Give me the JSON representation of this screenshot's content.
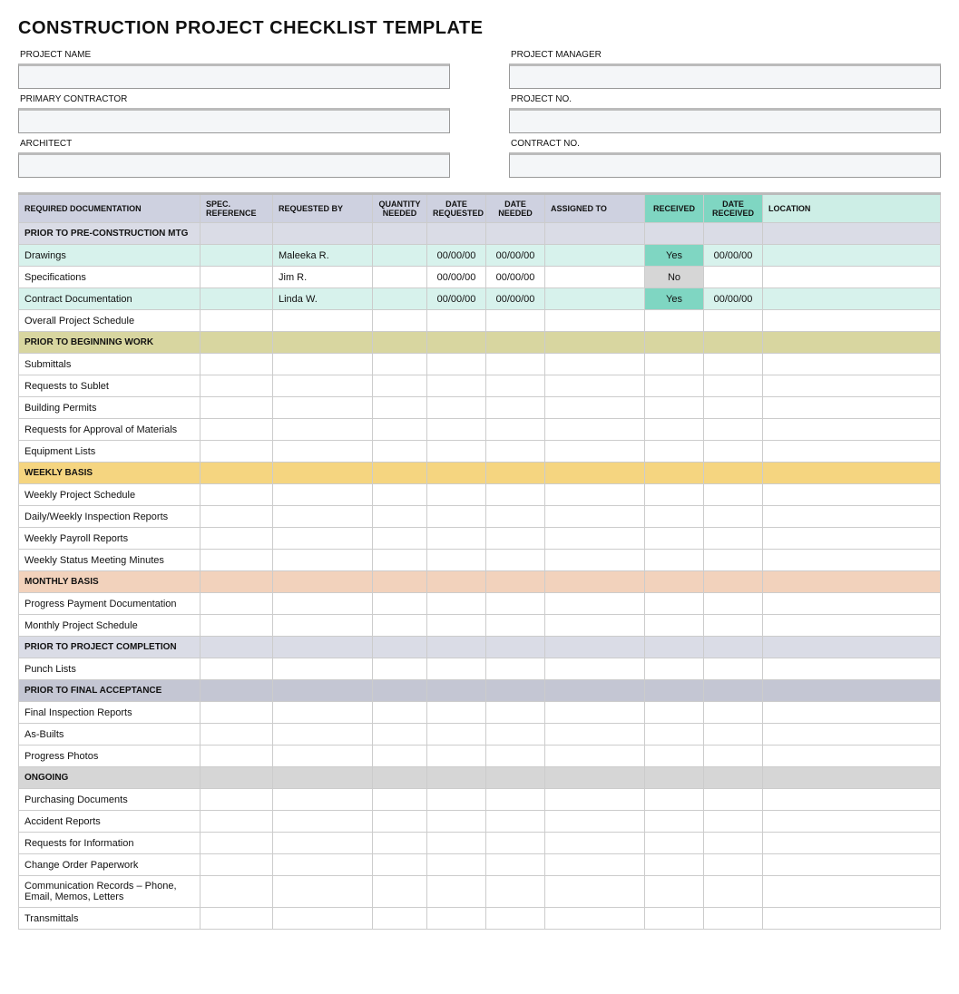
{
  "title": "CONSTRUCTION PROJECT CHECKLIST TEMPLATE",
  "fields": {
    "project_name_label": "PROJECT NAME",
    "project_manager_label": "PROJECT MANAGER",
    "primary_contractor_label": "PRIMARY CONTRACTOR",
    "project_no_label": "PROJECT NO.",
    "architect_label": "ARCHITECT",
    "contract_no_label": "CONTRACT NO.",
    "project_name": "",
    "project_manager": "",
    "primary_contractor": "",
    "project_no": "",
    "architect": "",
    "contract_no": ""
  },
  "headers": {
    "doc": "REQUIRED DOCUMENTATION",
    "spec": "SPEC. REFERENCE",
    "reqby": "REQUESTED BY",
    "qty": "QUANTITY NEEDED",
    "dreq": "DATE REQUESTED",
    "dneed": "DATE NEEDED",
    "asg": "ASSIGNED TO",
    "rec": "RECEIVED",
    "drec": "DATE RECEIVED",
    "loc": "LOCATION"
  },
  "sections": {
    "pre": "PRIOR TO PRE-CONSTRUCTION MTG",
    "beginwork": "PRIOR TO BEGINNING WORK",
    "weekly": "WEEKLY BASIS",
    "monthly": "MONTHLY BASIS",
    "completion": "PRIOR TO PROJECT COMPLETION",
    "finalacc": "PRIOR TO FINAL ACCEPTANCE",
    "ongoing": "ONGOING"
  },
  "rows": {
    "drawings": {
      "doc": "Drawings",
      "reqby": "Maleeka R.",
      "dreq": "00/00/00",
      "dneed": "00/00/00",
      "rec": "Yes",
      "drec": "00/00/00"
    },
    "specs": {
      "doc": "Specifications",
      "reqby": "Jim R.",
      "dreq": "00/00/00",
      "dneed": "00/00/00",
      "rec": "No"
    },
    "contractdoc": {
      "doc": "Contract Documentation",
      "reqby": "Linda W.",
      "dreq": "00/00/00",
      "dneed": "00/00/00",
      "rec": "Yes",
      "drec": "00/00/00"
    },
    "schedule": {
      "doc": "Overall Project Schedule"
    },
    "submittals": {
      "doc": "Submittals"
    },
    "sublet": {
      "doc": "Requests to Sublet"
    },
    "permits": {
      "doc": "Building Permits"
    },
    "materials": {
      "doc": "Requests for Approval of Materials"
    },
    "equip": {
      "doc": "Equipment Lists"
    },
    "wsched": {
      "doc": "Weekly Project Schedule"
    },
    "inspections": {
      "doc": "Daily/Weekly Inspection Reports"
    },
    "payroll": {
      "doc": "Weekly Payroll Reports"
    },
    "minutes": {
      "doc": "Weekly Status Meeting Minutes"
    },
    "paydoc": {
      "doc": "Progress Payment Documentation"
    },
    "msched": {
      "doc": "Monthly Project Schedule"
    },
    "punch": {
      "doc": "Punch Lists"
    },
    "finalinsp": {
      "doc": "Final Inspection Reports"
    },
    "asbuilts": {
      "doc": "As-Builts"
    },
    "photos": {
      "doc": "Progress Photos"
    },
    "purchasing": {
      "doc": "Purchasing Documents"
    },
    "accident": {
      "doc": "Accident Reports"
    },
    "rfi": {
      "doc": "Requests for Information"
    },
    "changeorder": {
      "doc": "Change Order Paperwork"
    },
    "comm": {
      "doc": "Communication Records – Phone, Email, Memos, Letters"
    },
    "transmittals": {
      "doc": "Transmittals"
    }
  }
}
